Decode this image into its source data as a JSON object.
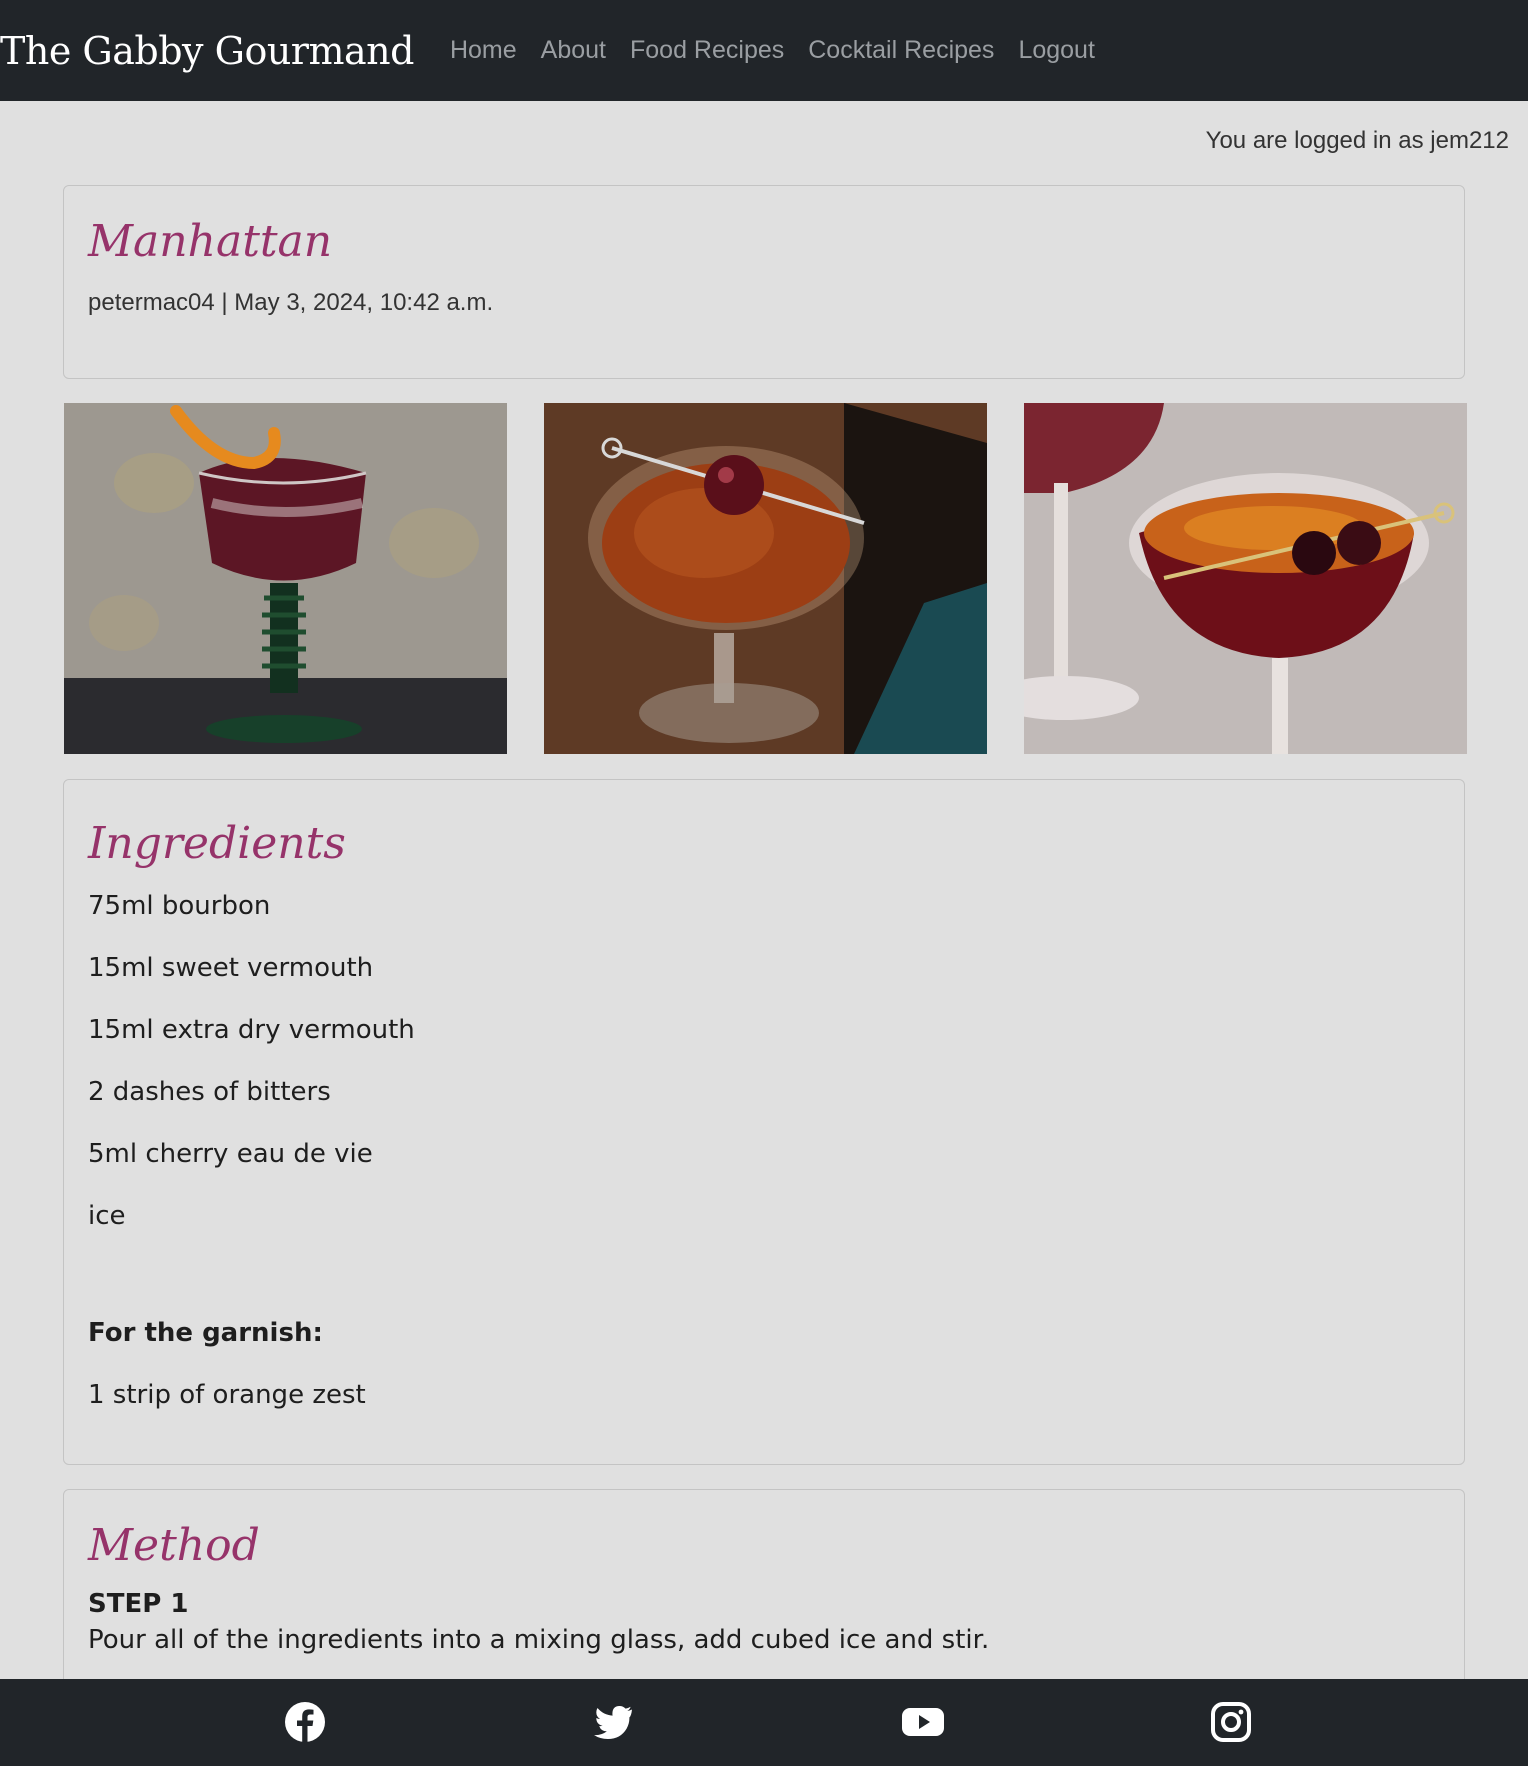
{
  "navbar": {
    "brand": "The Gabby Gourmand",
    "links": [
      "Home",
      "About",
      "Food Recipes",
      "Cocktail Recipes",
      "Logout"
    ]
  },
  "login_status": "You are logged in as jem212",
  "recipe": {
    "title": "Manhattan",
    "meta": "petermac04 | May 3, 2024, 10:42 a.m."
  },
  "ingredients": {
    "heading": "Ingredients",
    "items": [
      "75ml bourbon",
      "15ml sweet vermouth",
      "15ml extra dry vermouth",
      "2 dashes of bitters",
      "5ml cherry eau de vie",
      "ice"
    ],
    "garnish_heading": "For the garnish:",
    "garnish_items": [
      "1 strip of orange zest"
    ]
  },
  "method": {
    "heading": "Method",
    "step_label": "STEP 1",
    "step_text": "Pour all of the ingredients into a mixing glass, add cubed ice and stir."
  },
  "footer": {
    "icons": [
      "facebook-icon",
      "twitter-icon",
      "youtube-icon",
      "instagram-icon"
    ]
  },
  "colors": {
    "navbar": "#212529",
    "page_background": "#e0e0e0",
    "heading_accent": "#96336a"
  }
}
